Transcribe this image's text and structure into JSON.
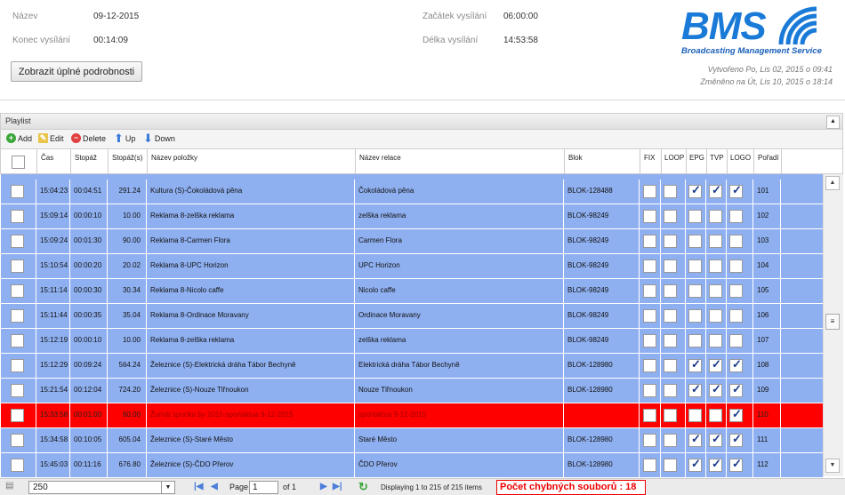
{
  "header": {
    "nazev_label": "Název",
    "nazev_value": "09-12-2015",
    "konec_label": "Konec vysílání",
    "konec_value": "00:14:09",
    "zacatek_label": "Začátek vysílání",
    "zacatek_value": "06:00:00",
    "delka_label": "Délka vysílání",
    "delka_value": "14:53:58",
    "details_button": "Zobrazit úplné podrobnosti",
    "logo_text": "BMS",
    "logo_subtitle": "Broadcasting Management Service",
    "created": "Vytvořeno Po, Lis 02, 2015 o 09:41",
    "modified": "Změněno na Út, Lis 10, 2015 o 18:14"
  },
  "panel": {
    "title": "Playlist",
    "toolbar": {
      "add": "Add",
      "edit": "Edit",
      "delete": "Delete",
      "up": "Up",
      "down": "Down"
    }
  },
  "columns": {
    "cas": "Čas",
    "stopaz": "Stopáž",
    "stopaz_s": "Stopáž(s)",
    "nazev_polozky": "Název položky",
    "nazev_relace": "Název relace",
    "blok": "Blok",
    "fix": "FIX",
    "loop": "LOOP",
    "epg": "EPG",
    "tvp": "TVP",
    "logo": "LOGO",
    "poradi": "Pořadí"
  },
  "rows": [
    {
      "cas": "15:04:23",
      "stopaz": "00:04:51",
      "sec": "291.24",
      "nazev": "Kultura (S)-Čokoládová pěna",
      "relace": "Čokoládová pěna",
      "blok": "BLOK-128488",
      "fix": false,
      "loop": false,
      "epg": true,
      "tvp": true,
      "logo": true,
      "poradi": "101",
      "error": false
    },
    {
      "cas": "15:09:14",
      "stopaz": "00:00:10",
      "sec": "10.00",
      "nazev": "Reklama 8-zelška reklama",
      "relace": "zelška reklama",
      "blok": "BLOK-98249",
      "fix": false,
      "loop": false,
      "epg": false,
      "tvp": false,
      "logo": false,
      "poradi": "102",
      "error": false
    },
    {
      "cas": "15:09:24",
      "stopaz": "00:01:30",
      "sec": "90.00",
      "nazev": "Reklama 8-Carmen Flora",
      "relace": "Carmen Flora",
      "blok": "BLOK-98249",
      "fix": false,
      "loop": false,
      "epg": false,
      "tvp": false,
      "logo": false,
      "poradi": "103",
      "error": false
    },
    {
      "cas": "15:10:54",
      "stopaz": "00:00:20",
      "sec": "20.02",
      "nazev": "Reklama 8-UPC Horizon",
      "relace": "UPC Horizon",
      "blok": "BLOK-98249",
      "fix": false,
      "loop": false,
      "epg": false,
      "tvp": false,
      "logo": false,
      "poradi": "104",
      "error": false
    },
    {
      "cas": "15:11:14",
      "stopaz": "00:00:30",
      "sec": "30.34",
      "nazev": "Reklama 8-Nicolo caffe",
      "relace": "Nicolo caffe",
      "blok": "BLOK-98249",
      "fix": false,
      "loop": false,
      "epg": false,
      "tvp": false,
      "logo": false,
      "poradi": "105",
      "error": false
    },
    {
      "cas": "15:11:44",
      "stopaz": "00:00:35",
      "sec": "35.04",
      "nazev": "Reklama 8-Ordinace Moravany",
      "relace": "Ordinace Moravany",
      "blok": "BLOK-98249",
      "fix": false,
      "loop": false,
      "epg": false,
      "tvp": false,
      "logo": false,
      "poradi": "106",
      "error": false
    },
    {
      "cas": "15:12:19",
      "stopaz": "00:00:10",
      "sec": "10.00",
      "nazev": "Reklama 8-zelška reklama",
      "relace": "zelška reklama",
      "blok": "BLOK-98249",
      "fix": false,
      "loop": false,
      "epg": false,
      "tvp": false,
      "logo": false,
      "poradi": "107",
      "error": false
    },
    {
      "cas": "15:12:29",
      "stopaz": "00:09:24",
      "sec": "564.24",
      "nazev": "Železnice (S)-Elektrická dráha Tábor Bechyně",
      "relace": "Elektrická dráha Tábor Bechyně",
      "blok": "BLOK-128980",
      "fix": false,
      "loop": false,
      "epg": true,
      "tvp": true,
      "logo": true,
      "poradi": "108",
      "error": false
    },
    {
      "cas": "15:21:54",
      "stopaz": "00:12:04",
      "sec": "724.20",
      "nazev": "Železnice (S)-Nouze Tlřnoukon",
      "relace": "Nouze Tlřnoukon",
      "blok": "BLOK-128980",
      "fix": false,
      "loop": false,
      "epg": true,
      "tvp": true,
      "logo": true,
      "poradi": "109",
      "error": false
    },
    {
      "cas": "15:33:58",
      "stopaz": "00:01:00",
      "sec": "60.00",
      "nazev": "Žurnál sportka by 2015-sportaktua 9-12-2015",
      "relace": "sportaktua 9-12-2015",
      "blok": "",
      "fix": false,
      "loop": false,
      "epg": false,
      "tvp": false,
      "logo": true,
      "poradi": "110",
      "error": true
    },
    {
      "cas": "15:34:58",
      "stopaz": "00:10:05",
      "sec": "605.04",
      "nazev": "Železnice (S)-Staré Město",
      "relace": "Staré Město",
      "blok": "BLOK-128980",
      "fix": false,
      "loop": false,
      "epg": true,
      "tvp": true,
      "logo": true,
      "poradi": "111",
      "error": false
    },
    {
      "cas": "15:45:03",
      "stopaz": "00:11:16",
      "sec": "676.80",
      "nazev": "Železnice (S)-ČDO Přerov",
      "relace": "ČDO Přerov",
      "blok": "BLOK-128980",
      "fix": false,
      "loop": false,
      "epg": true,
      "tvp": true,
      "logo": true,
      "poradi": "112",
      "error": false
    }
  ],
  "footer": {
    "page_size": "250",
    "page_label": "Page",
    "page_value": "1",
    "of_label": "of 1",
    "displaying": "Displaying 1 to 215 of 215 items",
    "errors": "Počet chybných souborů : 18"
  },
  "colors": {
    "row_bg": "#8fb0f0",
    "error_row_bg": "#ff0000",
    "logo_blue": "#1a7ad8",
    "error_text": "#e00000"
  }
}
